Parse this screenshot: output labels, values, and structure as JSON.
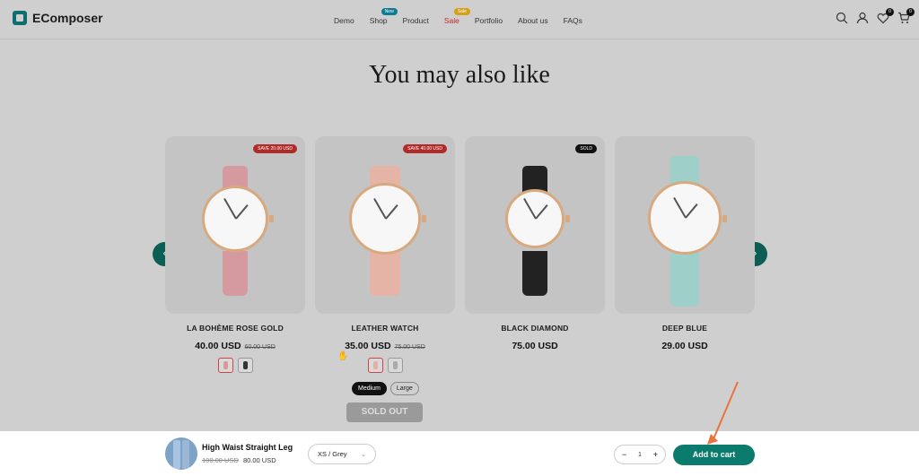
{
  "header": {
    "logo_text": "EComposer",
    "nav": [
      {
        "label": "Demo",
        "badge": ""
      },
      {
        "label": "Shop",
        "badge": "New"
      },
      {
        "label": "Product",
        "badge": ""
      },
      {
        "label": "Sale",
        "badge": "Sale"
      },
      {
        "label": "Portfolio",
        "badge": ""
      },
      {
        "label": "About us",
        "badge": ""
      },
      {
        "label": "FAQs",
        "badge": ""
      }
    ],
    "wishlist_count": "0",
    "cart_count": "0"
  },
  "section_title": "You may also like",
  "products": [
    {
      "name": "LA BOHÈME ROSE GOLD",
      "price": "40.00 USD",
      "old_price": "60.00 USD",
      "badge": "SAVE 20.00 USD",
      "strap_color": "#d59a9f"
    },
    {
      "name": "LEATHER WATCH",
      "price": "35.00 USD",
      "old_price": "75.00 USD",
      "badge": "SAVE 40.00 USD",
      "strap_color": "#e6b3a7"
    },
    {
      "name": "BLACK DIAMOND",
      "price": "75.00 USD",
      "old_price": "",
      "badge": "SOLD",
      "strap_color": "#222222"
    },
    {
      "name": "DEEP BLUE",
      "price": "29.00 USD",
      "old_price": "",
      "badge": "",
      "strap_color": "#9ecfc8"
    }
  ],
  "size_options": [
    "Medium",
    "Large"
  ],
  "sold_out_label": "SOLD OUT",
  "sticky_bar": {
    "title": "High Waist Straight Leg",
    "old_price": "100.00 USD",
    "price": "80.00 USD",
    "variant": "XS / Grey",
    "quantity": "1",
    "add_to_cart": "Add to cart"
  },
  "colors": {
    "accent": "#0b7b6e",
    "sale_badge": "#b02a2a",
    "annotation_arrow": "#e8743b"
  }
}
